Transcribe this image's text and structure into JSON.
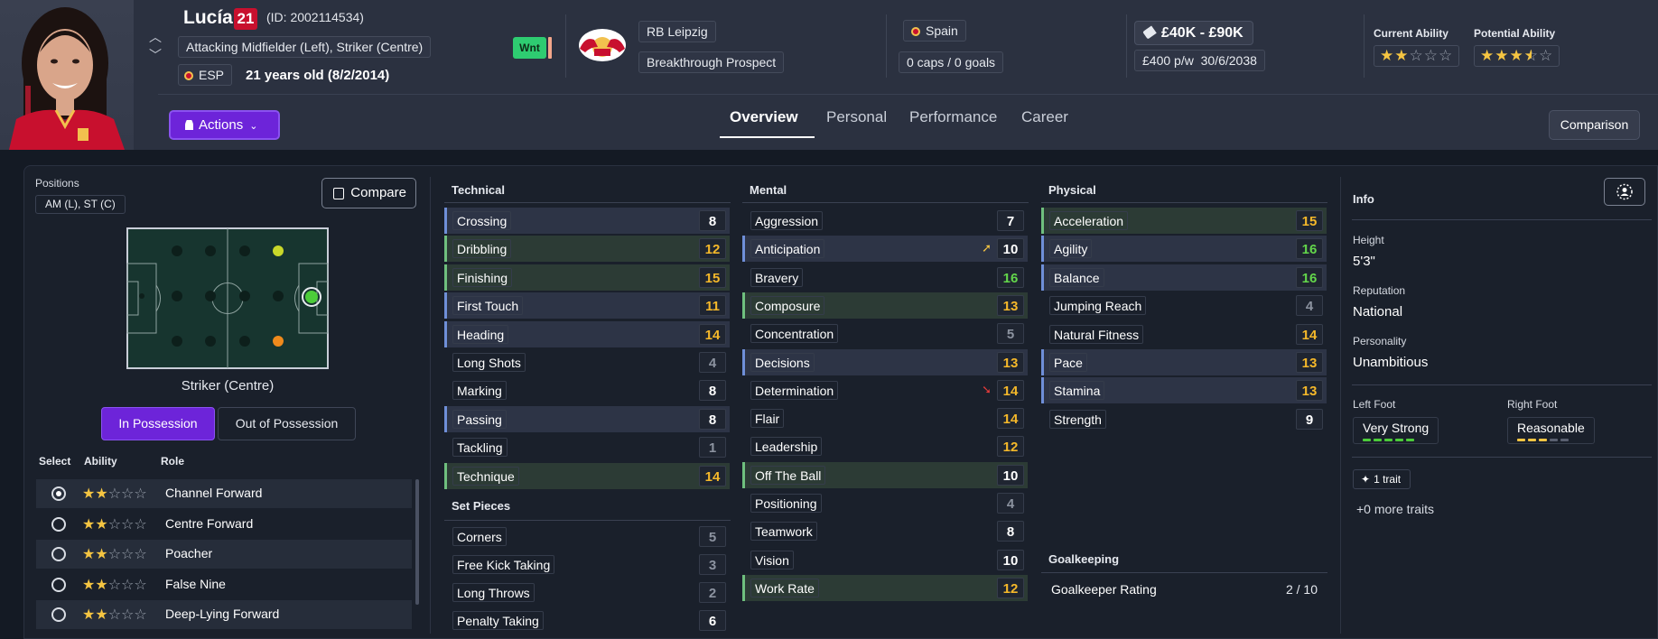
{
  "player": {
    "name": "Lucía",
    "number": "21",
    "id": "(ID: 2002114534)",
    "positions_full": "Attacking Midfielder (Left), Striker (Centre)",
    "nation_code": "ESP",
    "age": "21 years old (8/2/2014)",
    "wnt_badge": "Wnt"
  },
  "club": {
    "name": "RB Leipzig",
    "status": "Breakthrough Prospect"
  },
  "nation": {
    "name": "Spain",
    "caps": "0 caps / 0 goals"
  },
  "contract": {
    "value": "£40K - £90K",
    "wage": "£400 p/w",
    "expiry": "30/6/2038"
  },
  "ability": {
    "current_label": "Current Ability",
    "current_stars": 2,
    "potential_label": "Potential Ability",
    "potential_stars": 3.5
  },
  "nav": {
    "actions_label": "Actions",
    "tabs": [
      "Overview",
      "Personal",
      "Performance",
      "Career"
    ],
    "active_tab": "Overview",
    "comparison_label": "Comparison"
  },
  "positions_panel": {
    "label": "Positions",
    "value": "AM (L), ST (C)",
    "compare_label": "Compare",
    "pitch_caption": "Striker (Centre)",
    "in_possession": "In Possession",
    "out_possession": "Out of Possession",
    "headers": {
      "select": "Select",
      "ability": "Ability",
      "role": "Role"
    },
    "roles": [
      {
        "name": "Channel Forward",
        "stars": 2,
        "selected": true
      },
      {
        "name": "Centre Forward",
        "stars": 2,
        "selected": false
      },
      {
        "name": "Poacher",
        "stars": 2,
        "selected": false
      },
      {
        "name": "False Nine",
        "stars": 2,
        "selected": false
      },
      {
        "name": "Deep-Lying Forward",
        "stars": 2,
        "selected": false
      }
    ]
  },
  "attributes": {
    "technical": {
      "title": "Technical",
      "items": [
        {
          "name": "Crossing",
          "value": "8",
          "hl": "blue"
        },
        {
          "name": "Dribbling",
          "value": "12",
          "hl": "green"
        },
        {
          "name": "Finishing",
          "value": "15",
          "hl": "green"
        },
        {
          "name": "First Touch",
          "value": "11",
          "hl": "blue"
        },
        {
          "name": "Heading",
          "value": "14",
          "hl": "blue"
        },
        {
          "name": "Long Shots",
          "value": "4",
          "hl": ""
        },
        {
          "name": "Marking",
          "value": "8",
          "hl": ""
        },
        {
          "name": "Passing",
          "value": "8",
          "hl": "blue"
        },
        {
          "name": "Tackling",
          "value": "1",
          "hl": ""
        },
        {
          "name": "Technique",
          "value": "14",
          "hl": "green"
        }
      ]
    },
    "set_pieces": {
      "title": "Set Pieces",
      "items": [
        {
          "name": "Corners",
          "value": "5",
          "hl": ""
        },
        {
          "name": "Free Kick Taking",
          "value": "3",
          "hl": ""
        },
        {
          "name": "Long Throws",
          "value": "2",
          "hl": ""
        },
        {
          "name": "Penalty Taking",
          "value": "6",
          "hl": ""
        }
      ]
    },
    "mental": {
      "title": "Mental",
      "items": [
        {
          "name": "Aggression",
          "value": "7",
          "hl": ""
        },
        {
          "name": "Anticipation",
          "value": "10",
          "hl": "blue",
          "trend": "up"
        },
        {
          "name": "Bravery",
          "value": "16",
          "hl": ""
        },
        {
          "name": "Composure",
          "value": "13",
          "hl": "green"
        },
        {
          "name": "Concentration",
          "value": "5",
          "hl": ""
        },
        {
          "name": "Decisions",
          "value": "13",
          "hl": "blue"
        },
        {
          "name": "Determination",
          "value": "14",
          "hl": "",
          "trend": "down"
        },
        {
          "name": "Flair",
          "value": "14",
          "hl": ""
        },
        {
          "name": "Leadership",
          "value": "12",
          "hl": ""
        },
        {
          "name": "Off The Ball",
          "value": "10",
          "hl": "green"
        },
        {
          "name": "Positioning",
          "value": "4",
          "hl": ""
        },
        {
          "name": "Teamwork",
          "value": "8",
          "hl": ""
        },
        {
          "name": "Vision",
          "value": "10",
          "hl": ""
        },
        {
          "name": "Work Rate",
          "value": "12",
          "hl": "green"
        }
      ]
    },
    "physical": {
      "title": "Physical",
      "items": [
        {
          "name": "Acceleration",
          "value": "15",
          "hl": "green"
        },
        {
          "name": "Agility",
          "value": "16",
          "hl": "blue"
        },
        {
          "name": "Balance",
          "value": "16",
          "hl": "blue"
        },
        {
          "name": "Jumping Reach",
          "value": "4",
          "hl": ""
        },
        {
          "name": "Natural Fitness",
          "value": "14",
          "hl": ""
        },
        {
          "name": "Pace",
          "value": "13",
          "hl": "blue"
        },
        {
          "name": "Stamina",
          "value": "13",
          "hl": "blue"
        },
        {
          "name": "Strength",
          "value": "9",
          "hl": ""
        }
      ]
    },
    "goalkeeping": {
      "title": "Goalkeeping",
      "rating_label": "Goalkeeper Rating",
      "rating_value": "2 / 10"
    }
  },
  "info": {
    "title": "Info",
    "height_label": "Height",
    "height": "5'3\"",
    "reputation_label": "Reputation",
    "reputation": "National",
    "personality_label": "Personality",
    "personality": "Unambitious",
    "left_foot_label": "Left Foot",
    "left_foot": "Very Strong",
    "left_foot_level": 5,
    "right_foot_label": "Right Foot",
    "right_foot": "Reasonable",
    "right_foot_level": 3,
    "trait_label": "1 trait",
    "more_traits": "+0 more traits"
  },
  "colors": {
    "accent": "#6d24d9",
    "value_high": "#f5b82a",
    "value_top": "#63d64b",
    "value_low": "#8c93a0"
  }
}
